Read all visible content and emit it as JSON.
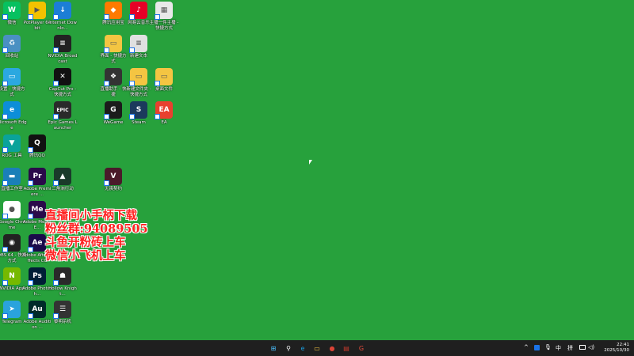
{
  "desktop": {
    "icons": [
      {
        "id": "wechat",
        "label": "微信",
        "color": "#07c160",
        "glyph": "W"
      },
      {
        "id": "potplayer",
        "label": "PotPlayer 64 bit",
        "color": "#f2c200",
        "glyph": "▶"
      },
      {
        "id": "idm",
        "label": "Internet Downlo...",
        "color": "#1c7ed6",
        "glyph": "↓"
      },
      {
        "id": "tencent-video",
        "label": "腾讯应用宝",
        "color": "#ff7a00",
        "glyph": "◆"
      },
      {
        "id": "netease-music",
        "label": "网易云音乐",
        "color": "#e60026",
        "glyph": "♪"
      },
      {
        "id": "sheet-file",
        "label": "主播一件主播 - 快捷方式",
        "color": "#e8e8e8",
        "glyph": "▦"
      },
      {
        "id": "recycle-bin",
        "label": "回收站",
        "color": "#4a90c2",
        "glyph": "♻"
      },
      {
        "id": "nvidia-broadcast",
        "label": "NVIDIA Broadcast",
        "color": "#222222",
        "glyph": "≡"
      },
      {
        "id": "folder-1",
        "label": "界面 - 快捷方式",
        "color": "#f4c542",
        "glyph": "▭"
      },
      {
        "id": "text-file",
        "label": "新建文本",
        "color": "#e0e0e0",
        "glyph": "≡"
      },
      {
        "id": "control-panel",
        "label": "设置 - 快捷方式",
        "color": "#2ba8e0",
        "glyph": "▭"
      },
      {
        "id": "capcut",
        "label": "CapCut Pro - 快捷方式",
        "color": "#111111",
        "glyph": "✕"
      },
      {
        "id": "obs-plugin",
        "label": "直播助手 - 快捷",
        "color": "#333333",
        "glyph": "❖"
      },
      {
        "id": "folder-2",
        "label": "新建文件夹 - 快捷方式",
        "color": "#f4c542",
        "glyph": "▭"
      },
      {
        "id": "folder-3",
        "label": "桌面文件",
        "color": "#f4c542",
        "glyph": "▭"
      },
      {
        "id": "edge",
        "label": "Microsoft Edge",
        "color": "#0c8ed8",
        "glyph": "e"
      },
      {
        "id": "epic",
        "label": "Epic Games Launcher",
        "color": "#2a2a2a",
        "glyph": "EPIC"
      },
      {
        "id": "wegame",
        "label": "WeGame",
        "color": "#1b1b1b",
        "glyph": "G"
      },
      {
        "id": "steam",
        "label": "Steam",
        "color": "#1b3a5c",
        "glyph": "S"
      },
      {
        "id": "ea",
        "label": "EA",
        "color": "#e8402f",
        "glyph": "EA"
      },
      {
        "id": "rog-app",
        "label": "ROG 工具",
        "color": "#0aa39a",
        "glyph": "▼"
      },
      {
        "id": "qq",
        "label": "腾讯QQ",
        "color": "#111111",
        "glyph": "Q"
      },
      {
        "id": "studio",
        "label": "直播工作室",
        "color": "#1a7fb8",
        "glyph": "▬"
      },
      {
        "id": "premiere",
        "label": "Adobe Premiere ...",
        "color": "#2a0a4a",
        "glyph": "Pr"
      },
      {
        "id": "game-1",
        "label": "三角洲行动",
        "color": "#1a3a2a",
        "glyph": "▲"
      },
      {
        "id": "game-2",
        "label": "无畏契约",
        "color": "#4a1a2a",
        "glyph": "V"
      },
      {
        "id": "chrome",
        "label": "Google Chrome",
        "color": "#ffffff",
        "glyph": "●"
      },
      {
        "id": "media-encoder",
        "label": "Adobe Media E...",
        "color": "#2a0a4a",
        "glyph": "Me"
      },
      {
        "id": "obs",
        "label": "OBS 64 - 快捷方式",
        "color": "#222222",
        "glyph": "◉"
      },
      {
        "id": "after-effects",
        "label": "Adobe After Effects CC",
        "color": "#1a0a4a",
        "glyph": "Ae"
      },
      {
        "id": "nvidia-app",
        "label": "NVIDIA App",
        "color": "#76b900",
        "glyph": "N"
      },
      {
        "id": "photoshop",
        "label": "Adobe Photosh...",
        "color": "#001e36",
        "glyph": "Ps"
      },
      {
        "id": "hollow-knight",
        "label": "Hollow Knight...",
        "color": "#2a2a2a",
        "glyph": "☗"
      },
      {
        "id": "telegram",
        "label": "Telegram",
        "color": "#2aa3dd",
        "glyph": "➤"
      },
      {
        "id": "audition",
        "label": "Adobe Audition ...",
        "color": "#002a2a",
        "glyph": "Au"
      },
      {
        "id": "dbd",
        "label": "黎明杀机",
        "color": "#333333",
        "glyph": "☰"
      }
    ]
  },
  "overlay": {
    "line1": "直播间小手柄下载",
    "line2": "粉丝群:94089505",
    "line3": "斗鱼开粉砖上车",
    "line4": "微信小飞机上车"
  },
  "taskbar": {
    "apps": [
      {
        "id": "start",
        "glyph": "⊞",
        "color": "#4cc2ff"
      },
      {
        "id": "search",
        "glyph": "⚲",
        "color": "#ffffff"
      },
      {
        "id": "edge",
        "glyph": "e",
        "color": "#1ba1e2"
      },
      {
        "id": "explorer",
        "glyph": "▭",
        "color": "#f4c542"
      },
      {
        "id": "chrome",
        "glyph": "●",
        "color": "#db4437"
      },
      {
        "id": "app-red",
        "glyph": "▤",
        "color": "#c0392b"
      },
      {
        "id": "app-g",
        "glyph": "G",
        "color": "#e74c3c"
      }
    ],
    "tray": {
      "chevron": "^",
      "ime_mode": "中",
      "ime_kind": "拼",
      "volume": "◁)"
    },
    "clock": {
      "time": "22:41",
      "date": "2025/10/30"
    }
  }
}
